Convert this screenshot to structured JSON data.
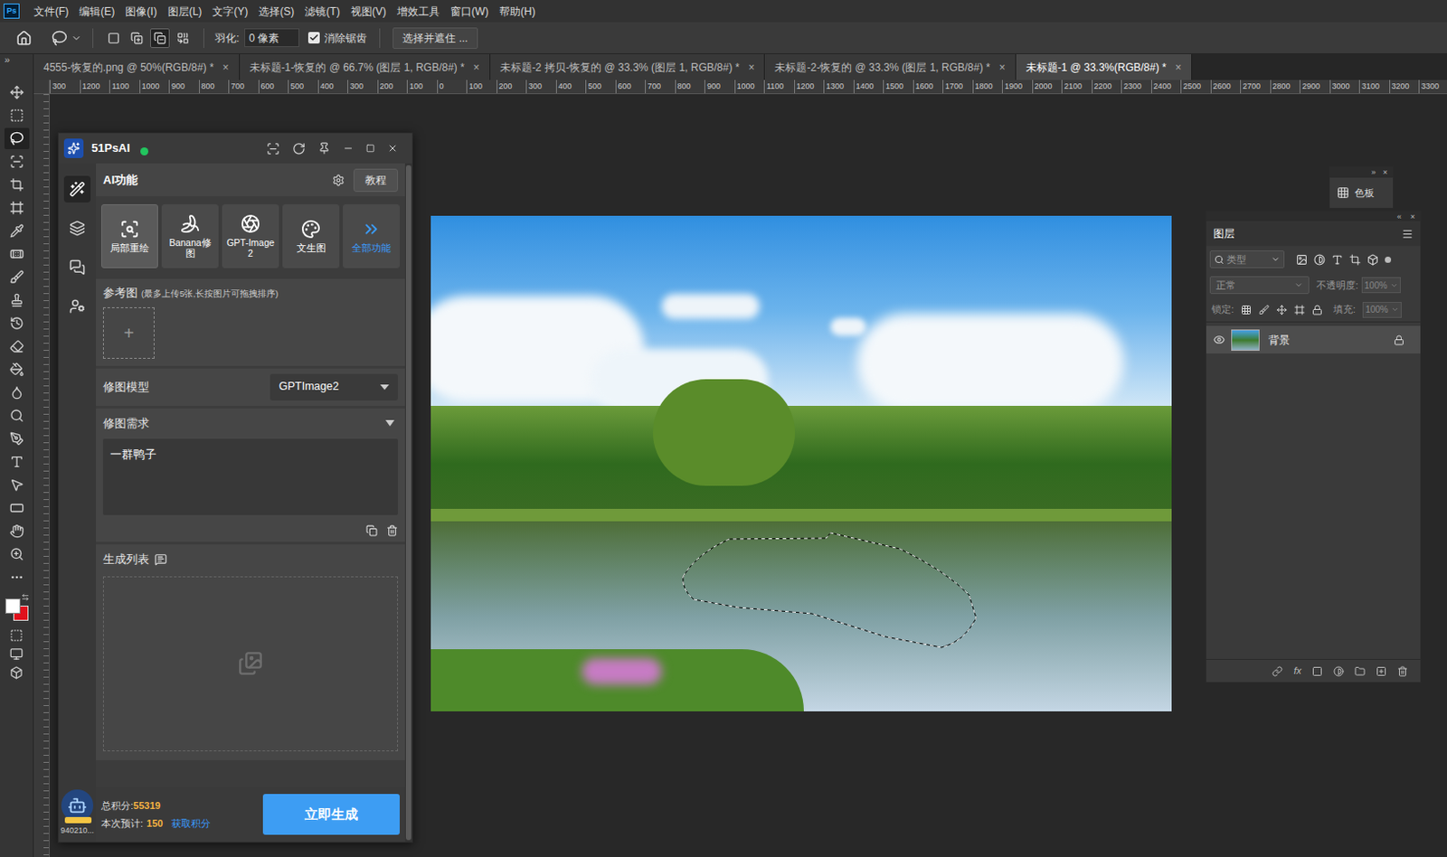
{
  "app_badge": "Ps",
  "menu": [
    "文件(F)",
    "编辑(E)",
    "图像(I)",
    "图层(L)",
    "文字(Y)",
    "选择(S)",
    "滤镜(T)",
    "视图(V)",
    "增效工具",
    "窗口(W)",
    "帮助(H)"
  ],
  "options_bar": {
    "selection_modes": [
      {
        "kind": "new",
        "selected": false
      },
      {
        "kind": "add",
        "selected": false
      },
      {
        "kind": "subtract",
        "selected": true
      },
      {
        "kind": "intersect",
        "selected": false
      }
    ],
    "feather_label": "羽化:",
    "feather_value": "0 像素",
    "antialias": {
      "label": "消除锯齿",
      "checked": true
    },
    "mask_button": "选择并遮住 ..."
  },
  "toolbar_collapse": "»",
  "tools": [
    {
      "kind": "move",
      "selected": false
    },
    {
      "kind": "marquee",
      "selected": false
    },
    {
      "kind": "lasso",
      "selected": true
    },
    {
      "kind": "object",
      "selected": false
    },
    {
      "kind": "crop",
      "selected": false
    },
    {
      "kind": "frame",
      "selected": false
    },
    {
      "kind": "eyedropper",
      "selected": false
    },
    {
      "kind": "healing",
      "selected": false
    },
    {
      "kind": "brush",
      "selected": false
    },
    {
      "kind": "stamp",
      "selected": false
    },
    {
      "kind": "history",
      "selected": false
    },
    {
      "kind": "eraser",
      "selected": false
    },
    {
      "kind": "gradient",
      "selected": false
    },
    {
      "kind": "blur",
      "selected": false
    },
    {
      "kind": "dodge",
      "selected": false
    },
    {
      "kind": "pen",
      "selected": false
    },
    {
      "kind": "type",
      "selected": false
    },
    {
      "kind": "path",
      "selected": false
    },
    {
      "kind": "shape",
      "selected": false
    },
    {
      "kind": "hand",
      "selected": false
    },
    {
      "kind": "zoom",
      "selected": false
    },
    {
      "kind": "more",
      "selected": false
    }
  ],
  "colors": {
    "foreground": "#ffffff",
    "background": "#e0101c"
  },
  "doc_tabs": [
    {
      "label": "4555-恢复的.png @ 50%(RGB/8#) *",
      "selected": false
    },
    {
      "label": "未标题-1-恢复的 @ 66.7% (图层 1, RGB/8#) *",
      "selected": false
    },
    {
      "label": "未标题-2 拷贝-恢复的 @ 33.3% (图层 1, RGB/8#) *",
      "selected": false
    },
    {
      "label": "未标题-2-恢复的 @ 33.3% (图层 1, RGB/8#) *",
      "selected": false
    },
    {
      "label": "未标题-1 @ 33.3%(RGB/8#) *",
      "selected": true
    }
  ],
  "tab_close": "×",
  "ruler_labels": [
    "300",
    "1200",
    "1100",
    "1000",
    "900",
    "800",
    "700",
    "600",
    "500",
    "400",
    "300",
    "200",
    "100",
    "0",
    "100",
    "200",
    "300",
    "400",
    "500",
    "600",
    "700",
    "800",
    "900",
    "1000",
    "1100",
    "1200",
    "1300",
    "1400",
    "1500",
    "1600",
    "1700",
    "1800",
    "1900",
    "2000",
    "2100",
    "2200",
    "2300",
    "2400",
    "2500",
    "2600",
    "2700",
    "2800",
    "2900",
    "3000",
    "3100",
    "3200",
    "3300"
  ],
  "plugin": {
    "title": "51PsAI",
    "online": true,
    "sidebar": [
      {
        "kind": "ai",
        "selected": true
      },
      {
        "kind": "layers",
        "selected": false
      },
      {
        "kind": "chat",
        "selected": false
      },
      {
        "kind": "account",
        "selected": false
      }
    ],
    "section_title": "AI功能",
    "tutorial_button": "教程",
    "features": [
      {
        "kind": "inpaint",
        "label": "局部重绘",
        "selected": true,
        "highlight": false
      },
      {
        "kind": "banana",
        "label": "Banana修图",
        "selected": false,
        "highlight": false
      },
      {
        "kind": "gpt",
        "label": "GPT-Image2",
        "selected": false,
        "highlight": false
      },
      {
        "kind": "t2i",
        "label": "文生图",
        "selected": false,
        "highlight": false
      },
      {
        "kind": "all",
        "label": "全部功能",
        "selected": false,
        "highlight": true
      }
    ],
    "reference": {
      "label": "参考图",
      "hint": "(最多上传5张,长按图片可拖拽排序)",
      "add": "+"
    },
    "model": {
      "label": "修图模型",
      "value": "GPTImage2"
    },
    "prompt": {
      "label": "修图需求",
      "expanded": true,
      "value": "一群鸭子"
    },
    "results": {
      "label": "生成列表"
    },
    "footer": {
      "user_id": "940210...",
      "total_label": "总积分:",
      "total_value": "55319",
      "estimate_label": "本次预计:",
      "estimate_value": "150",
      "earn_link": "获取积分",
      "generate_button": "立即生成"
    }
  },
  "swatches_panel": {
    "title": "色板",
    "collapse": "»",
    "close": "×"
  },
  "layers_panel": {
    "expand": "«",
    "close": "×",
    "title": "图层",
    "filter_placeholder": "类型",
    "blend_mode": "正常",
    "opacity_label": "不透明度:",
    "opacity": "100%",
    "lock_label": "锁定:",
    "fill_label": "填充:",
    "fill": "100%",
    "fx_label": "fx",
    "layers": [
      {
        "name": "背景",
        "visible": true,
        "locked": true,
        "selected": true
      }
    ]
  }
}
